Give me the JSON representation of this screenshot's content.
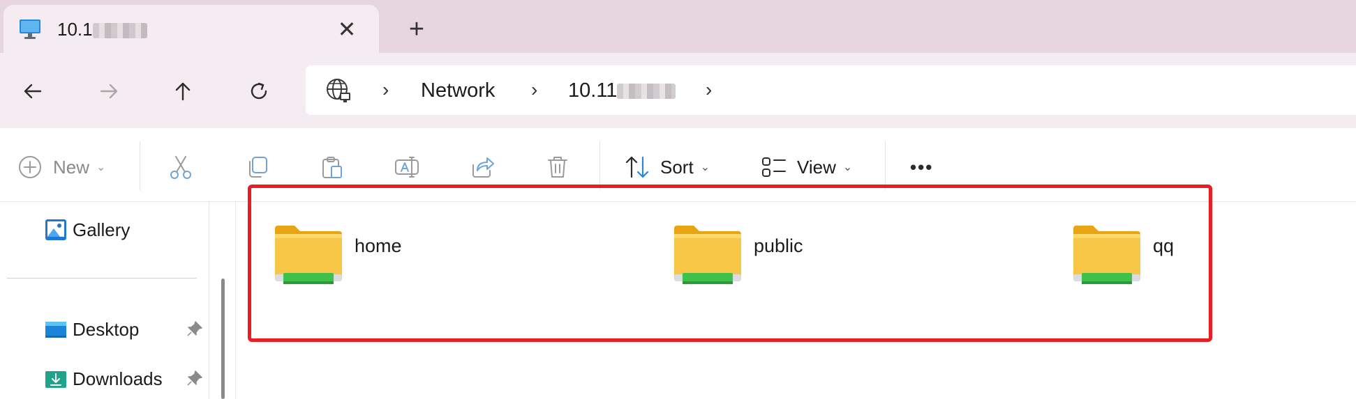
{
  "tab": {
    "title": "10.1",
    "close_glyph": "✕",
    "new_tab_glyph": "+",
    "icon": "monitor-icon"
  },
  "nav": {
    "back": "back-arrow-icon",
    "forward": "forward-arrow-icon",
    "up": "up-arrow-icon",
    "refresh": "refresh-icon"
  },
  "address": {
    "icon": "network-globe-icon",
    "separator": "›",
    "crumbs": [
      "Network",
      "10.11"
    ]
  },
  "toolbar": {
    "new_label": "New",
    "sort_label": "Sort",
    "view_label": "View",
    "more_glyph": "•••",
    "chevron": "⌄"
  },
  "sidebar": {
    "items": [
      {
        "label": "Gallery",
        "icon": "gallery-icon",
        "pinned": false
      },
      {
        "label": "Desktop",
        "icon": "desktop-folder-icon",
        "pinned": true
      },
      {
        "label": "Downloads",
        "icon": "downloads-folder-icon",
        "pinned": true
      }
    ]
  },
  "content": {
    "folders": [
      {
        "name": "home"
      },
      {
        "name": "public"
      },
      {
        "name": "qq"
      }
    ]
  },
  "colors": {
    "titlebar": "#e7d5e0",
    "navbar": "#f4ecf0",
    "highlight": "#ec1c24",
    "folder": "#f8c646",
    "share_bar": "#3fc04a"
  }
}
